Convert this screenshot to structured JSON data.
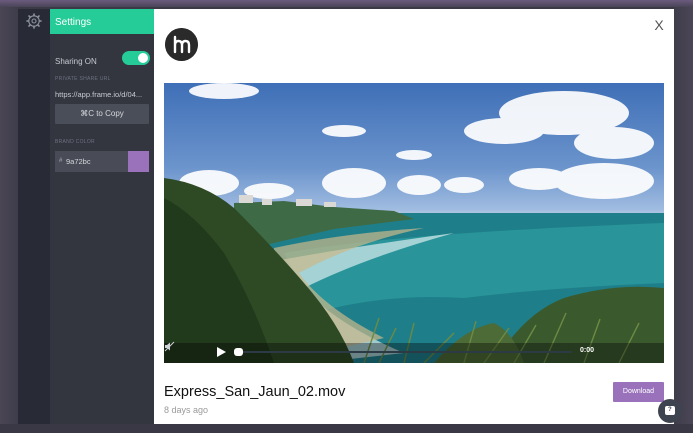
{
  "settings": {
    "title": "Settings",
    "sharing_label": "Sharing ON",
    "sharing_on": true,
    "private_share_url_label": "PRIVATE SHARE URL",
    "share_url": "https://app.frame.io/d/04...",
    "copy_label": "⌘C to Copy",
    "brand_color_label": "BRAND COLOR",
    "brand_color_hash": "#",
    "brand_color_value": "9a72bc",
    "brand_color": "#9a72bc"
  },
  "player": {
    "time": "0:00",
    "icons": [
      "play-icon",
      "mute-icon"
    ]
  },
  "file": {
    "name": "Express_San_Jaun_02.mov",
    "age": "8 days ago",
    "download_label": "Download"
  },
  "modal": {
    "close_glyph": "X"
  },
  "colors": {
    "accent_green": "#25cc97",
    "brand_purple": "#9a72bc"
  }
}
